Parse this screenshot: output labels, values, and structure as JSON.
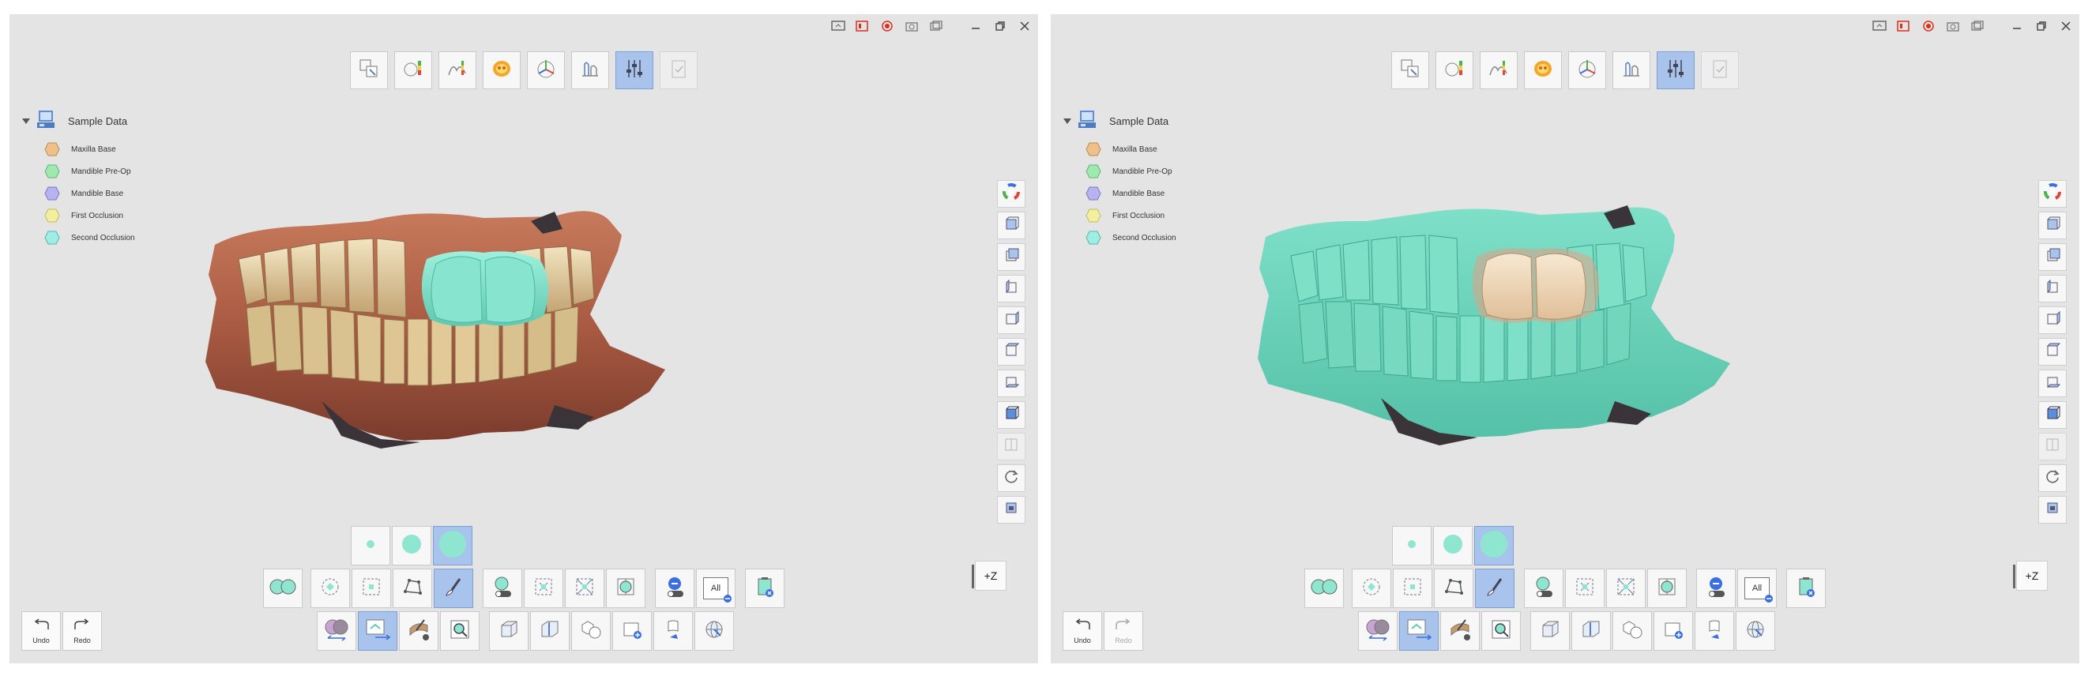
{
  "panels": [
    {
      "tree": {
        "root": "Sample Data",
        "items": [
          {
            "label": "Maxilla Base",
            "color": "#f0c08a"
          },
          {
            "label": "Mandible Pre-Op",
            "color": "#9fe8b0"
          },
          {
            "label": "Mandible Base",
            "color": "#b6b3f0"
          },
          {
            "label": "First Occlusion",
            "color": "#f3eea0"
          },
          {
            "label": "Second Occlusion",
            "color": "#9eeee6"
          }
        ]
      },
      "undo_label": "Undo",
      "redo_label": "Redo",
      "redo_enabled": true,
      "z_label": "+Z",
      "scene_mode": "texture"
    },
    {
      "tree": {
        "root": "Sample Data",
        "items": [
          {
            "label": "Maxilla Base",
            "color": "#f0c08a"
          },
          {
            "label": "Mandible Pre-Op",
            "color": "#9fe8b0"
          },
          {
            "label": "Mandible Base",
            "color": "#b6b3f0"
          },
          {
            "label": "First Occlusion",
            "color": "#f3eea0"
          },
          {
            "label": "Second Occlusion",
            "color": "#9eeee6"
          }
        ]
      },
      "undo_label": "Undo",
      "redo_label": "Redo",
      "redo_enabled": false,
      "z_label": "+Z",
      "scene_mode": "mint"
    }
  ],
  "all_label": "All",
  "colors": {
    "panel_bg": "#e4e4e4",
    "accent_active": "#a9c4ec",
    "mint": "#6fd8c2",
    "record": "#d9301e"
  }
}
